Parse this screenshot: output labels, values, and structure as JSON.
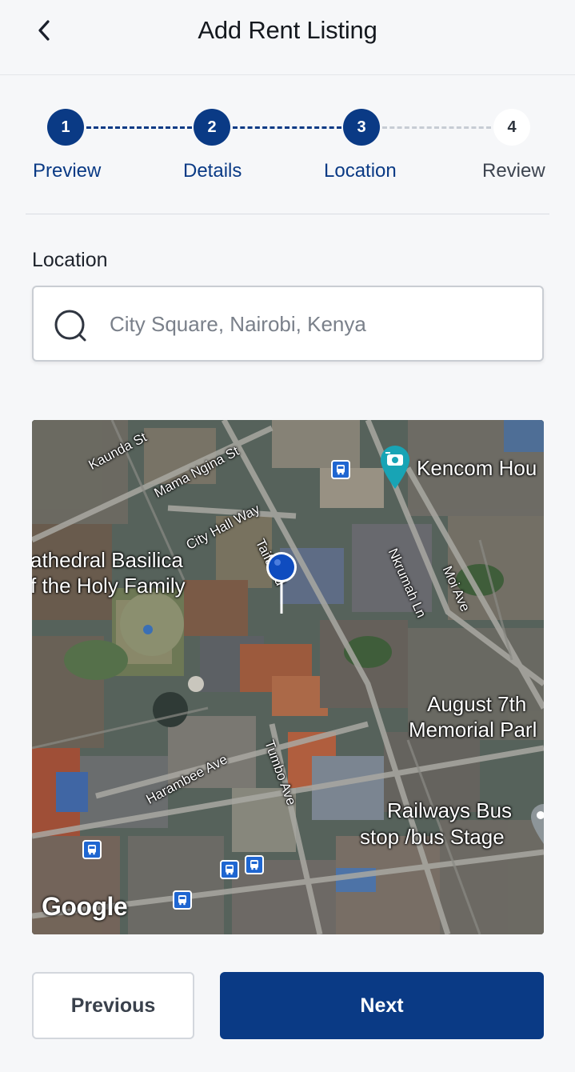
{
  "header": {
    "title": "Add Rent Listing",
    "back_icon": "chevron-left-icon"
  },
  "stepper": {
    "current_step": 3,
    "steps": [
      {
        "number": "1",
        "label": "Preview",
        "status": "completed"
      },
      {
        "number": "2",
        "label": "Details",
        "status": "completed"
      },
      {
        "number": "3",
        "label": "Location",
        "status": "active"
      },
      {
        "number": "4",
        "label": "Review",
        "status": "pending"
      }
    ]
  },
  "location": {
    "label": "Location",
    "search_value": "",
    "search_placeholder": "City Square, Nairobi, Kenya",
    "search_icon": "search-icon"
  },
  "map": {
    "streets": [
      "Kaunda St",
      "Mama Ngina St",
      "City Hall Way",
      "Taifa Rd",
      "Nkrumah Ln",
      "Moi Ave",
      "Harambee Ave",
      "Tumbo Ave"
    ],
    "places": {
      "cathedral_line1": "athedral Basilica",
      "cathedral_line2": "f the Holy Family",
      "kencom": "Kencom Hou",
      "august_line1": "August 7th",
      "august_line2": "Memorial Parl",
      "railways_line1": "Railways Bus",
      "railways_line2": "stop /bus Stage"
    },
    "attribution": "Google"
  },
  "actions": {
    "previous_label": "Previous",
    "next_label": "Next"
  },
  "colors": {
    "primary": "#0a3a85",
    "pending_step": "#ffffff",
    "pending_line": "#c7ccd4",
    "map_pin": "#0f4cbf",
    "poi_marker": "#18a4b5"
  }
}
